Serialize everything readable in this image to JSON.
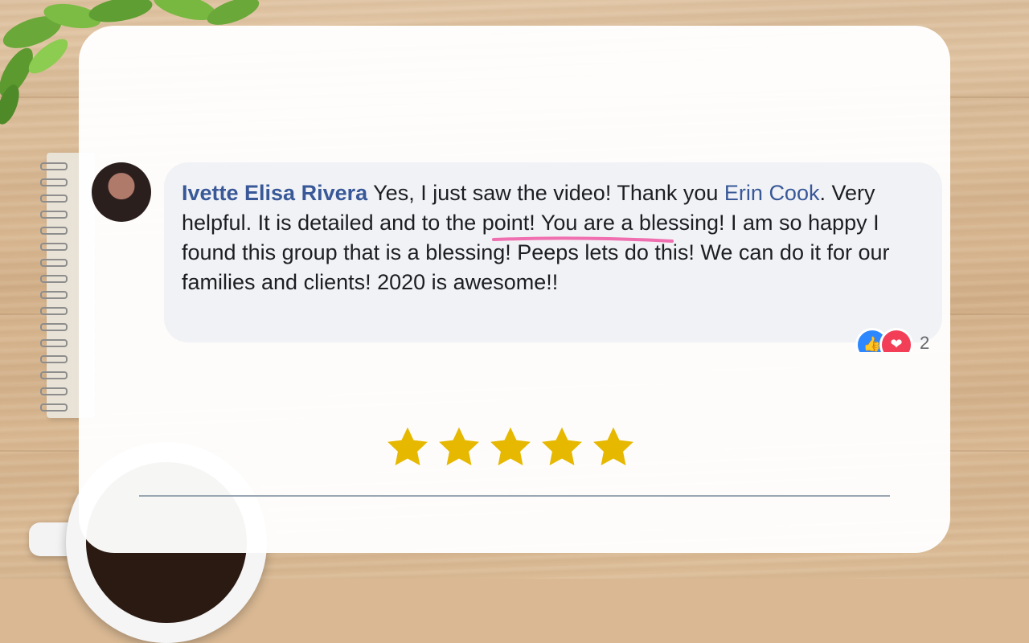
{
  "comment": {
    "author": "Ivette Elisa Rivera",
    "text_before_mention": " Yes, I just saw the video! Thank you ",
    "mention": "Erin Cook",
    "text_after_mention": ". Very helpful. It is detailed and to the point! You are a blessing! I am so happy I found this group that is a blessing! Peeps lets do this! We can do it for our families and clients! 2020 is awesome!!",
    "reaction_count": "2"
  },
  "rating": {
    "stars": 5,
    "max": 5
  },
  "colors": {
    "author": "#385898",
    "star": "#e6b800",
    "bubble": "#f1f2f5",
    "underline": "#f06fb0"
  },
  "icons": {
    "like": "thumbs-up-icon",
    "love": "heart-icon"
  }
}
